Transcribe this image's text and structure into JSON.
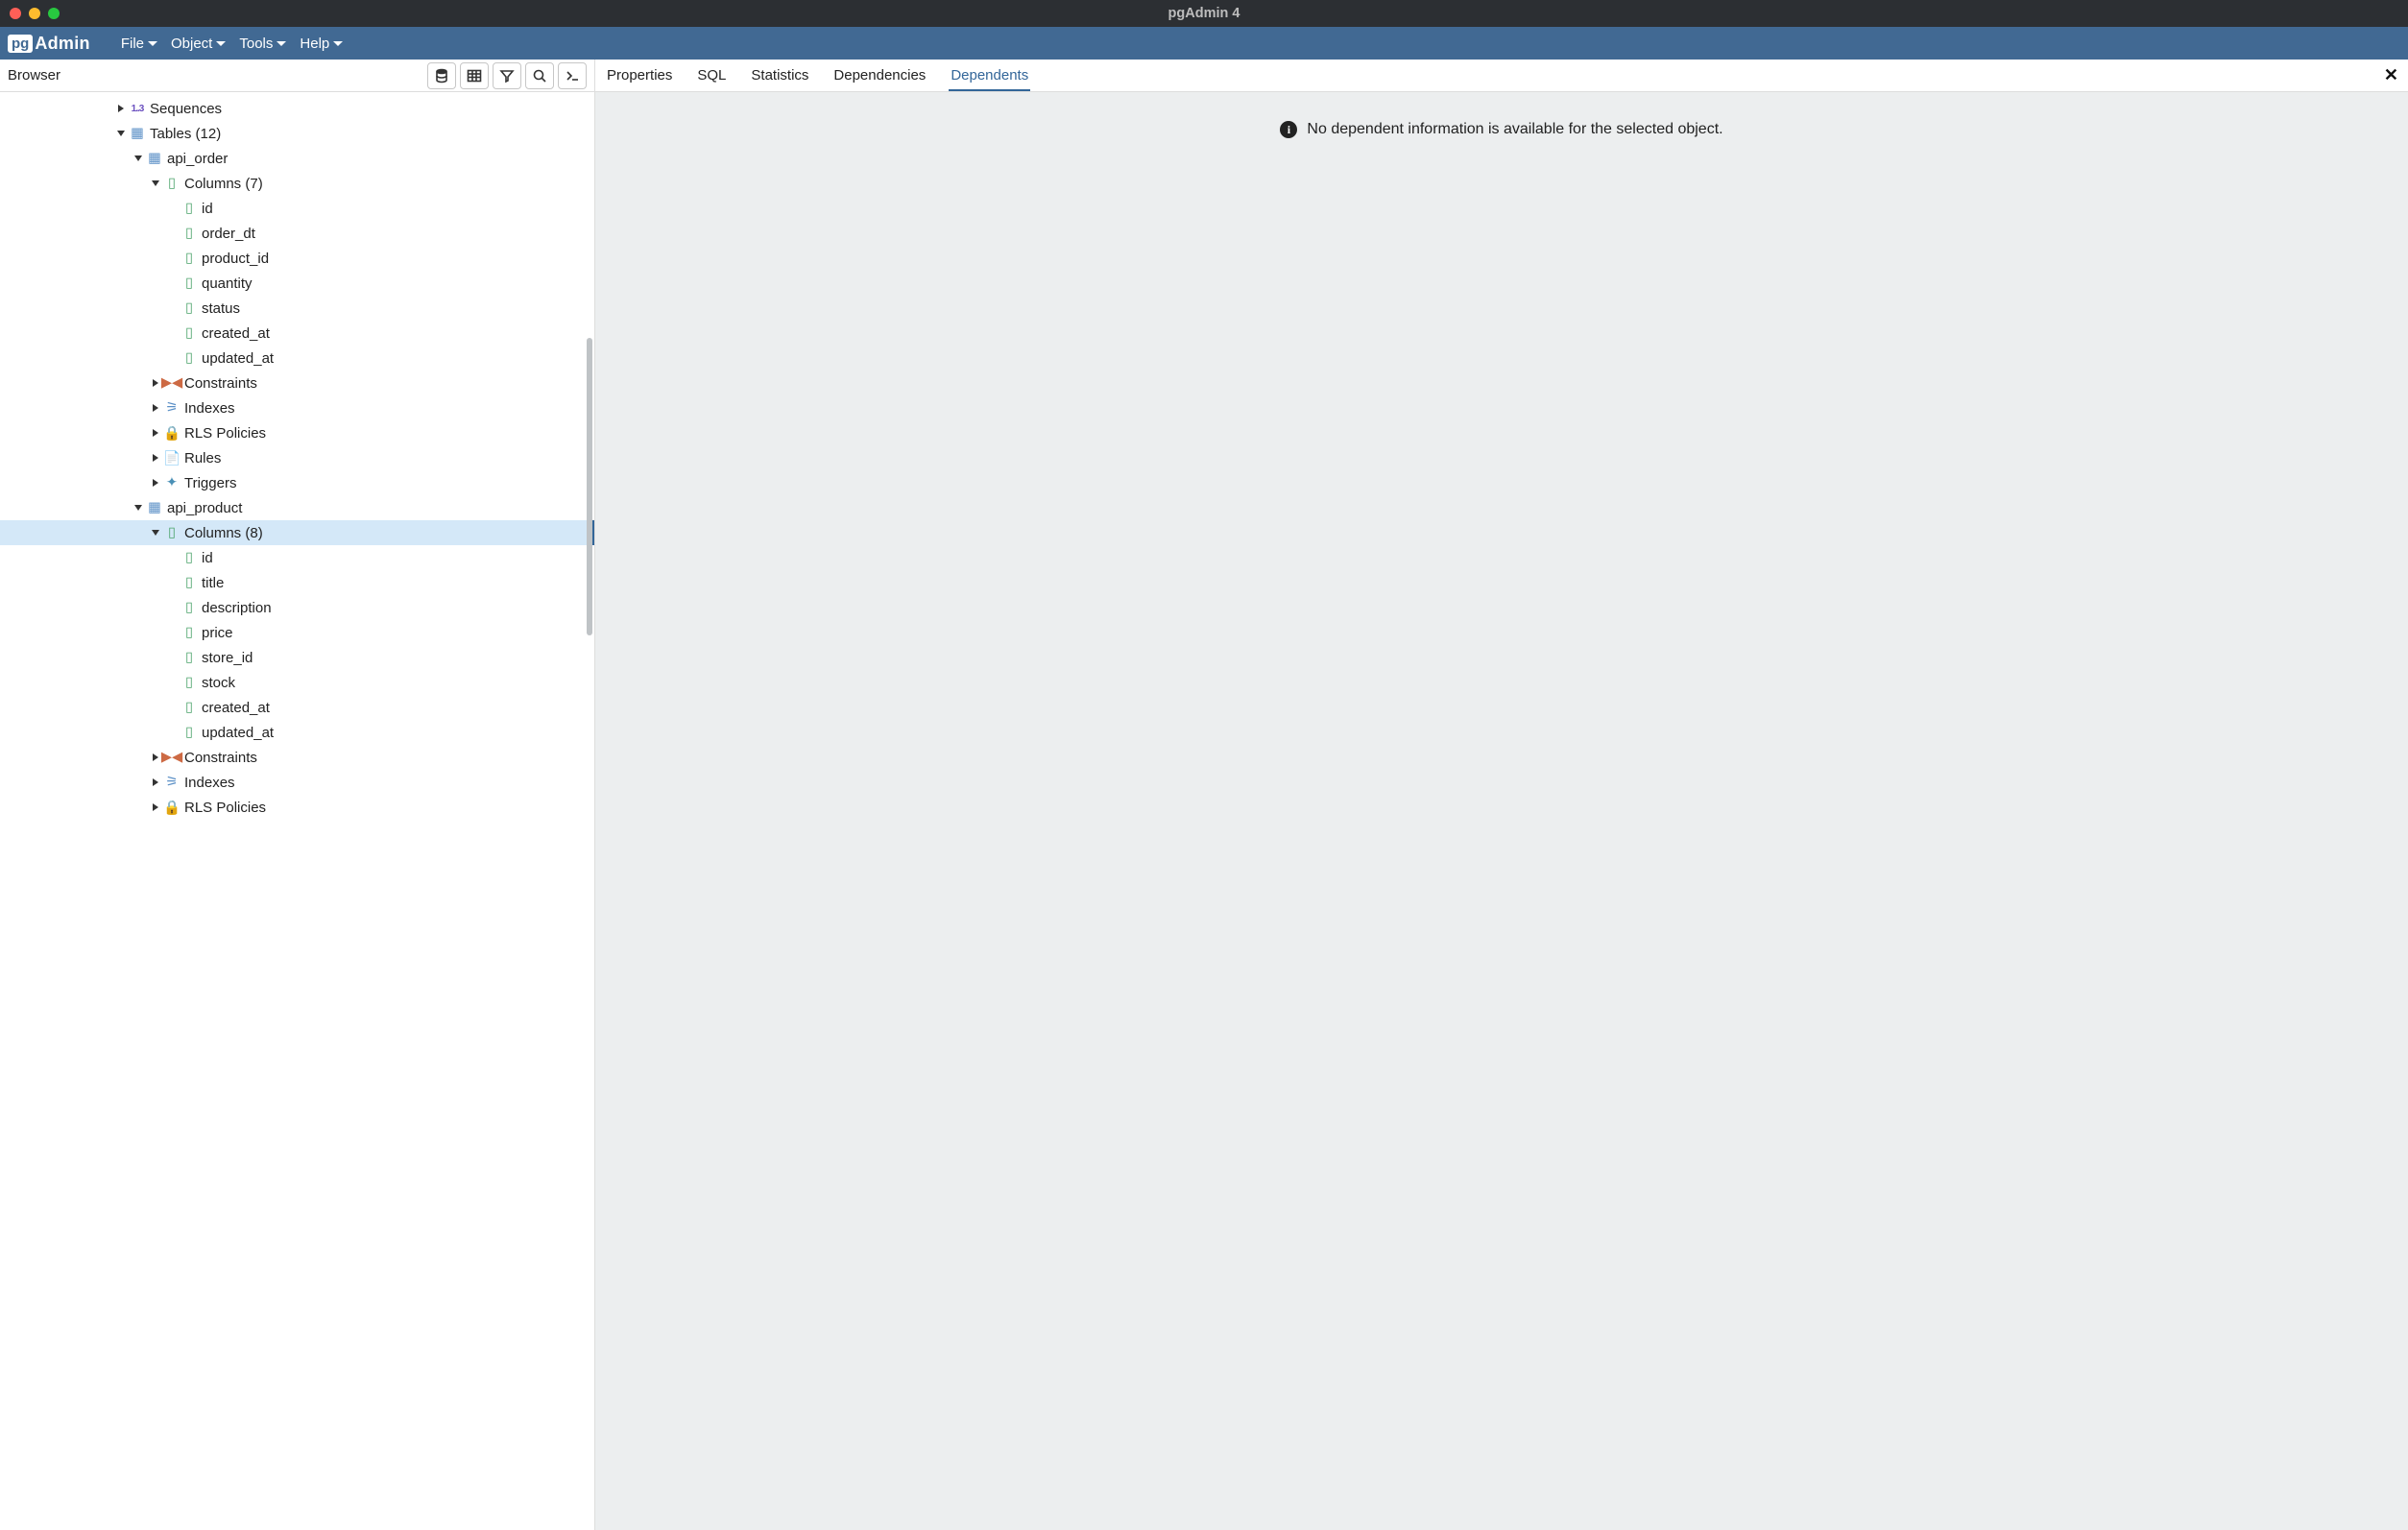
{
  "titlebar": {
    "title": "pgAdmin 4"
  },
  "logo": {
    "pg": "pg",
    "admin": "Admin"
  },
  "menu": {
    "file": "File",
    "object": "Object",
    "tools": "Tools",
    "help": "Help"
  },
  "sidebar": {
    "title": "Browser"
  },
  "tree": {
    "sequences": "Sequences",
    "tables": "Tables (12)",
    "table_api_order": "api_order",
    "columns_order": "Columns (7)",
    "order_cols": {
      "c0": "id",
      "c1": "order_dt",
      "c2": "product_id",
      "c3": "quantity",
      "c4": "status",
      "c5": "created_at",
      "c6": "updated_at"
    },
    "constraints": "Constraints",
    "indexes": "Indexes",
    "rls": "RLS Policies",
    "rules": "Rules",
    "triggers": "Triggers",
    "table_api_product": "api_product",
    "columns_product": "Columns (8)",
    "product_cols": {
      "c0": "id",
      "c1": "title",
      "c2": "description",
      "c3": "price",
      "c4": "store_id",
      "c5": "stock",
      "c6": "created_at",
      "c7": "updated_at"
    }
  },
  "tabs": {
    "properties": "Properties",
    "sql": "SQL",
    "statistics": "Statistics",
    "dependencies": "Dependencies",
    "dependents": "Dependents"
  },
  "main": {
    "message": "No dependent information is available for the selected object."
  }
}
